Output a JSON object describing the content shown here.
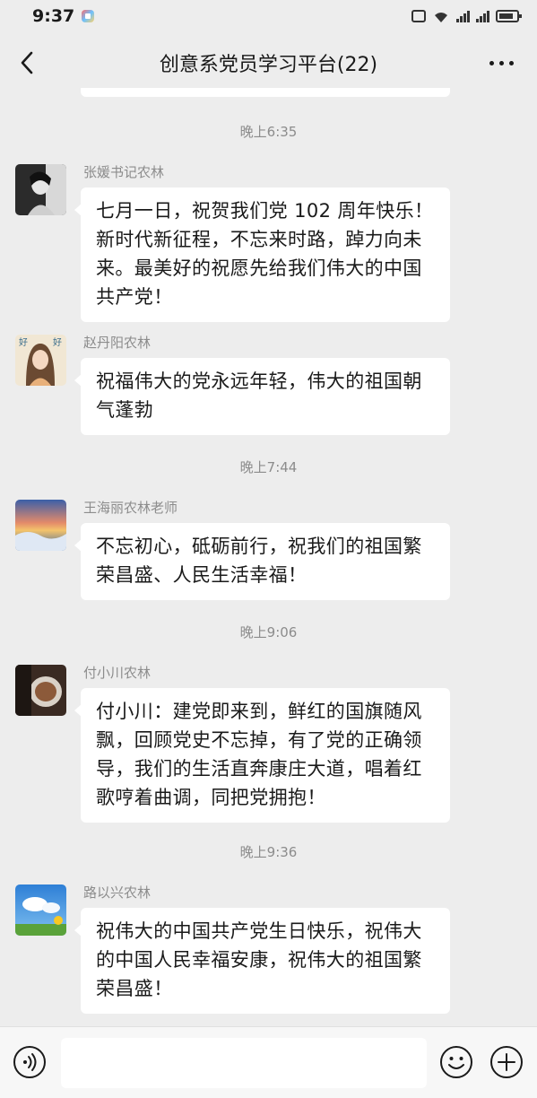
{
  "status_bar": {
    "time": "9:37"
  },
  "header": {
    "title": "创意系党员学习平台(22)"
  },
  "messages": [
    {
      "timestamp": "晚上6:35",
      "sender": "张媛书记农林",
      "text": "七月一日，祝贺我们党 102 周年快乐！新时代新征程，不忘来时路，踔力向未来。最美好的祝愿先给我们伟大的中国共产党！"
    },
    {
      "timestamp": "",
      "sender": "赵丹阳农林",
      "text": "祝福伟大的党永远年轻，伟大的祖国朝气蓬勃"
    },
    {
      "timestamp": "晚上7:44",
      "sender": "王海丽农林老师",
      "text": "不忘初心，砥砺前行，祝我们的祖国繁荣昌盛、人民生活幸福！"
    },
    {
      "timestamp": "晚上9:06",
      "sender": "付小川农林",
      "text": "付小川：建党即来到，鲜红的国旗随风飘，回顾党史不忘掉，有了党的正确领导，我们的生活直奔康庄大道，唱着红歌哼着曲调，同把党拥抱！"
    },
    {
      "timestamp": "晚上9:36",
      "sender": "路以兴农林",
      "text": "祝伟大的中国共产党生日快乐，祝伟大的中国人民幸福安康，祝伟大的祖国繁荣昌盛！"
    }
  ],
  "input": {
    "value": ""
  },
  "icons": {
    "back": "chevron-left-icon",
    "more": "more-dots-icon",
    "voice": "voice-icon",
    "emoji": "emoji-icon",
    "plus": "plus-icon"
  }
}
